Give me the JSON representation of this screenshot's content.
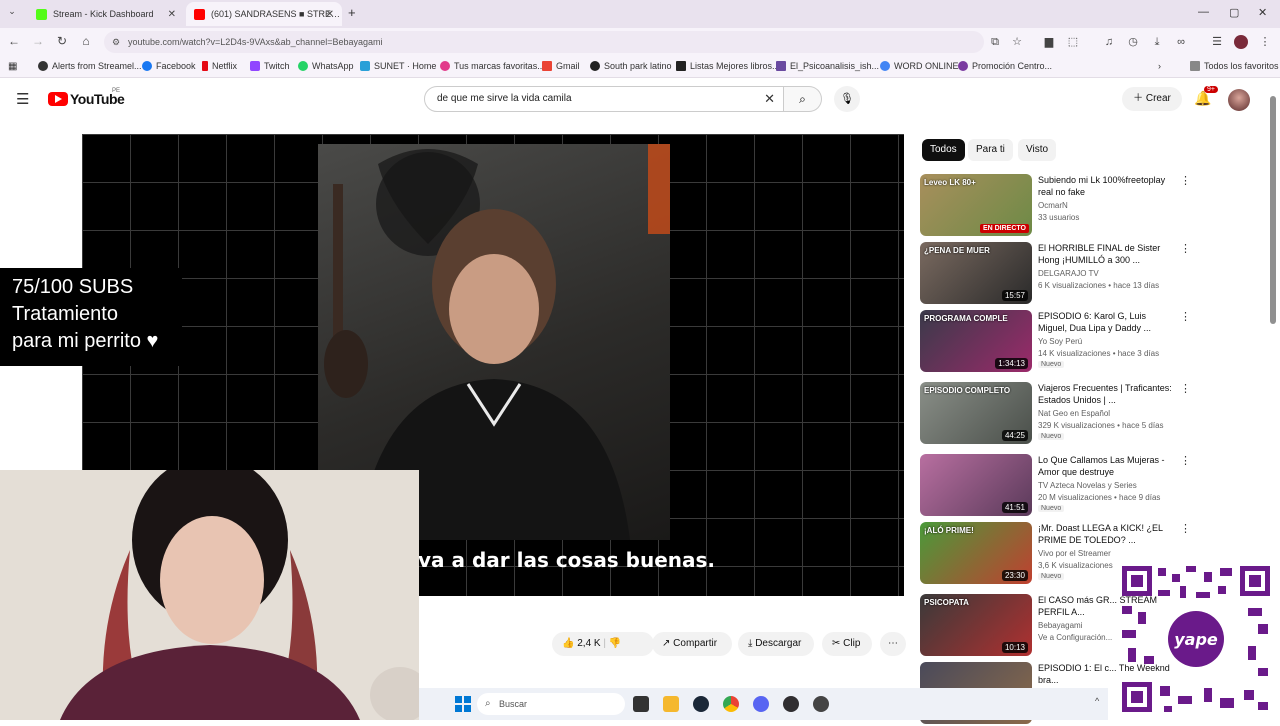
{
  "browser": {
    "tabs": [
      {
        "title": "Stream - Kick Dashboard",
        "color": "#53fc18"
      },
      {
        "title": "(601) SANDRASENS ■ STRE…",
        "color": "#ff0000"
      }
    ],
    "url": "youtube.com/watch?v=L2D4s-9VAxs&ab_channel=Bebayagami",
    "bookmarks": [
      "Alerts from Streamel...",
      "Facebook",
      "Netflix",
      "Twitch",
      "WhatsApp",
      "SUNET · Home",
      "Tus marcas favoritas...",
      "Gmail",
      "South park latino",
      "Listas Mejores libros...",
      "El_Psicoanalisis_ish...",
      "WORD ONLINE",
      "Promoción Centro...",
      "Todos los favoritos"
    ]
  },
  "youtube": {
    "logo": "YouTube",
    "country": "PE",
    "search_value": "de que me sirve la vida camila",
    "create_label": "Crear",
    "notif_count": "9+"
  },
  "player": {
    "subtitle": "va a dar las cosas buenas."
  },
  "overlay": {
    "subs_line1": "75/100 SUBS",
    "subs_line2": "Tratamiento",
    "subs_line3": "para mi perrito ♥"
  },
  "actions": {
    "likes": "2,4 K",
    "share": "Compartir",
    "download": "Descargar",
    "clip": "Clip"
  },
  "sidebar": {
    "chips": [
      "Todos",
      "Para ti",
      "Visto"
    ],
    "videos": [
      {
        "title": "Subiendo mi Lk 100%freetoplay real no fake",
        "channel": "OcmarN",
        "meta": "33 usuarios",
        "badge": "EN DIRECTO",
        "thumb_text": "Leveo LK 80+",
        "colors": [
          "#a88f5c",
          "#6d8a46"
        ]
      },
      {
        "title": "El HORRIBLE FINAL de Sister Hong ¡HUMILLÓ a 300 ...",
        "channel": "DELGARAJO TV",
        "meta": "6 K visualizaciones • hace 13 días",
        "duration": "15:57",
        "thumb_text": "¿PENA DE MUER",
        "colors": [
          "#7a6a60",
          "#2a2a2a"
        ]
      },
      {
        "title": "EPISODIO 6: Karol G, Luis Miguel, Dua Lipa y Daddy ...",
        "channel": "Yo Soy Perú",
        "meta": "14 K visualizaciones • hace 3 días",
        "nuevo": "Nuevo",
        "duration": "1:34:13",
        "thumb_text": "PROGRAMA COMPLE",
        "colors": [
          "#3a3a4a",
          "#9b2a6a"
        ]
      },
      {
        "title": "Viajeros Frecuentes | Traficantes: Estados Unidos | ...",
        "channel": "Nat Geo en Español",
        "meta": "329 K visualizaciones • hace 5 días",
        "nuevo": "Nuevo",
        "duration": "44:25",
        "thumb_text": "EPISODIO COMPLETO",
        "colors": [
          "#8a8f88",
          "#4a4f4a"
        ]
      },
      {
        "title": "Lo Que Callamos Las Mujeras - Amor que destruye",
        "channel": "TV Azteca Novelas y Series",
        "meta": "20 M visualizaciones • hace 9 días",
        "nuevo": "Nuevo",
        "duration": "41:51",
        "thumb_text": "",
        "colors": [
          "#b86fa0",
          "#5a3a5a"
        ]
      },
      {
        "title": "¡Mr. Doast LLEGA a KICK! ¿EL PRIME DE TOLEDO? ...",
        "channel": "Vivo por el Streamer",
        "meta": "3,6 K visualizaciones",
        "nuevo": "Nuevo",
        "duration": "23:30",
        "thumb_text": "¡ALÓ PRIME!",
        "colors": [
          "#4a9a3a",
          "#c04030"
        ]
      },
      {
        "title": "El CASO más GR... STREAM PERFIL A...",
        "channel": "Bebayagami",
        "meta": "Ve a Configuración...",
        "duration": "10:13",
        "thumb_text": "PSICOPATA",
        "colors": [
          "#3a3a3a",
          "#b03030"
        ]
      },
      {
        "title": "EPISODIO 1: El c... The Weeknd bra...",
        "channel": "",
        "meta": "",
        "duration": "",
        "thumb_text": "",
        "colors": [
          "#4a4a5a",
          "#8a6a4a"
        ]
      }
    ]
  },
  "taskbar": {
    "search_label": "Buscar"
  },
  "qr": {
    "label": "yape"
  }
}
